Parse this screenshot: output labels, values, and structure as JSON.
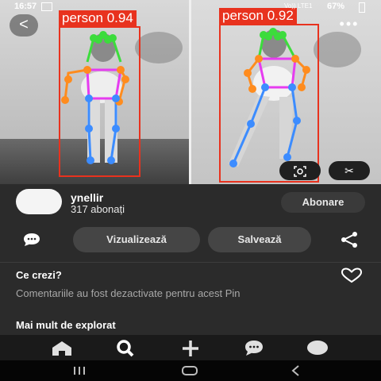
{
  "status_bar": {
    "time": "16:57",
    "battery": "67%",
    "signal": "Vo)) LTE1"
  },
  "detections": [
    {
      "label": "person 0.94"
    },
    {
      "label": "person 0.92"
    }
  ],
  "colors": {
    "bbox": "#e8321e",
    "head": "#3cdc3c",
    "arms": "#ff8c1e",
    "torso": "#e63cf0",
    "legs": "#3c8cff"
  },
  "profile": {
    "username": "ynellir",
    "subscribers": "317 abonați",
    "subscribe_label": "Abonare"
  },
  "actions": {
    "visualize_label": "Vizualizează",
    "save_label": "Salvează"
  },
  "comments": {
    "title": "Ce crezi?",
    "disabled_text": "Comentariile au fost dezactivate pentru acest Pin"
  },
  "more_section": "Mai mult de explorat",
  "icons": {
    "back": "back-arrow-icon",
    "more": "more-icon",
    "lens": "lens-icon",
    "cut": "scissors-icon",
    "comment": "chat-bubble-icon",
    "share": "share-icon",
    "heart": "heart-icon",
    "home": "home-icon",
    "search": "search-icon",
    "create": "plus-icon",
    "messages": "messages-icon",
    "profile": "profile-icon"
  }
}
